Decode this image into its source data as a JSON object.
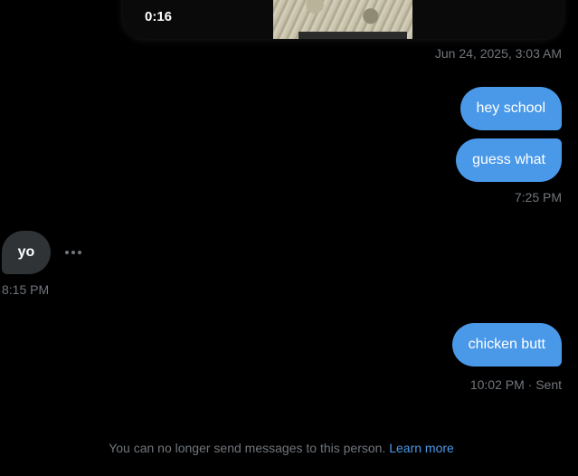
{
  "video": {
    "duration": "0:16"
  },
  "messages": {
    "video_timestamp": "Jun 24, 2025, 3:03 AM",
    "sent_group_1": [
      {
        "text": "hey school"
      },
      {
        "text": "guess what"
      }
    ],
    "sent_group_1_time": "7:25 PM",
    "received": {
      "text": "yo"
    },
    "received_time": "8:15 PM",
    "sent_group_2": [
      {
        "text": "chicken butt"
      }
    ],
    "sent_group_2_time": "10:02 PM · Sent"
  },
  "notice": {
    "text": "You can no longer send messages to this person.",
    "link": "Learn more"
  },
  "colors": {
    "background": "#000000",
    "sent_bubble": "#4a99e9",
    "received_bubble": "#2f3336",
    "muted_text": "#71767b",
    "link": "#4a99e9"
  },
  "icons": {
    "more": "more-horizontal-icon"
  }
}
